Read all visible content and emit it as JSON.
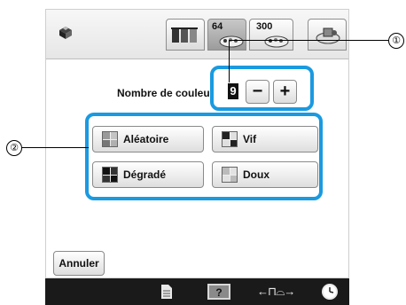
{
  "tabs": {
    "t64_label": "64",
    "t300_label": "300"
  },
  "color_count": {
    "label": "Nombre de couleu",
    "value": "9",
    "minus_label": "−",
    "plus_label": "+"
  },
  "buttons": {
    "random": "Aléatoire",
    "vivid": "Vif",
    "gradient": "Dégradé",
    "soft": "Doux"
  },
  "cancel_label": "Annuler",
  "annotations": {
    "one": "①",
    "two": "②"
  },
  "statusbar": {
    "presser_foot_glyph": "←⊓⌓→"
  },
  "colors": {
    "callout": "#1a9ae0",
    "statusbar": "#1a1a1a"
  }
}
